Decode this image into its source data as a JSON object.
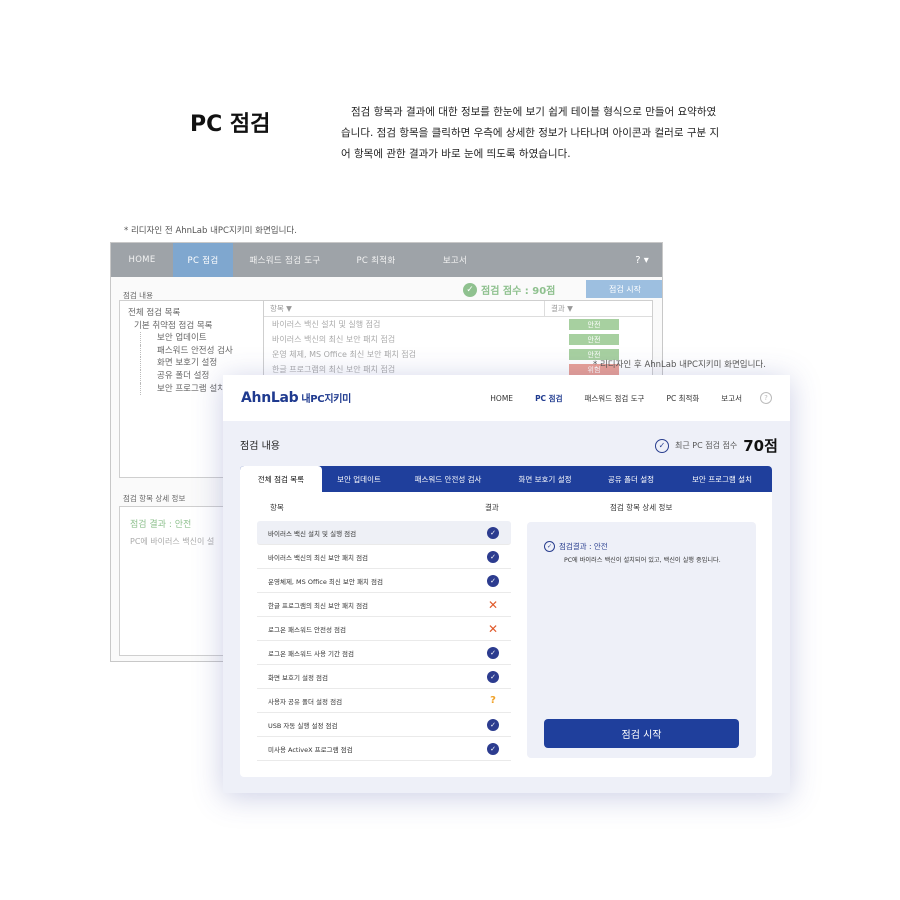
{
  "header": {
    "title": "PC 점검",
    "description": "점검 항목과 결과에 대한 정보를 한눈에 보기 쉽게 테이블 형식으로 만들어 요약하였습니다. 점검 항목을 클릭하면 우측에 상세한 정보가 나타나며 아이콘과 컬러로 구분 지어 항목에 관한 결과가 바로 눈에 띄도록 하였습니다."
  },
  "old": {
    "caption": "* 리디자인 전 AhnLab 내PC지키미 화면입니다.",
    "nav": [
      "HOME",
      "PC 점검",
      "패스워드 점검 도구",
      "PC 최적화",
      "보고서"
    ],
    "help": "? ▾",
    "section_title": "점검 내용",
    "score": "점검 점수 : 90점",
    "start_button": "점검 시작",
    "tree": {
      "root": "전체 점검 목록",
      "group": "기본 취약점 점검 목록",
      "children": [
        "보안 업데이트",
        "패스워드 안전성 검사",
        "화면 보호기 설정",
        "공유 폴더 설정",
        "보안 프로그램 설치"
      ]
    },
    "table": {
      "headers": [
        "항목 ▼",
        "결과 ▼"
      ],
      "rows": [
        {
          "item": "바이러스 백신 설치 및 실행 점검",
          "result": "안전",
          "color": "#a7d0a0"
        },
        {
          "item": "바이러스 백신의 최신 보안 패치 점검",
          "result": "안전",
          "color": "#a7d0a0"
        },
        {
          "item": "운영 체제, MS Office 최신 보안 패치 점검",
          "result": "안전",
          "color": "#a7d0a0"
        },
        {
          "item": "한글 프로그램의 최신 보안 패치 점검",
          "result": "위험",
          "color": "#e9a096"
        }
      ]
    },
    "detail_title": "점검 항목 상세 정보",
    "detail_result": "점검 결과 : 안전",
    "detail_desc": "PC에 바이러스 백신이 설"
  },
  "new": {
    "caption": "* 리디자인 후 AhnLab 내PC지키미 화면입니다.",
    "logo": "AhnLab",
    "logo_sub": "내PC지키미",
    "nav": [
      "HOME",
      "PC 점검",
      "패스워드 점검 도구",
      "PC 최적화",
      "보고서"
    ],
    "help": "?",
    "section_title": "점검 내용",
    "score_label": "최근 PC 점검 점수",
    "score_value": "70점",
    "tabs": [
      "전체 점검 목록",
      "보안 업데이트",
      "패스워드 안전성 검사",
      "화면 보호기 설정",
      "공유 폴더 설정",
      "보안 프로그램 설치"
    ],
    "col_item": "항목",
    "col_result": "결과",
    "col_detail": "점검 항목 상세 정보",
    "items": [
      {
        "label": "바이러스 백신 설치 및 실행 점검",
        "status": "ok"
      },
      {
        "label": "바이러스 백신의 최신 보안 패치 점검",
        "status": "ok"
      },
      {
        "label": "운영체제, MS Office 최신 보안 패치 점검",
        "status": "ok"
      },
      {
        "label": "한글 프로그램의 최신 보안 패치 점검",
        "status": "bad"
      },
      {
        "label": "로그온 패스워드 안전성 점검",
        "status": "bad"
      },
      {
        "label": "로그온 패스워드 사용 기간 점검",
        "status": "ok"
      },
      {
        "label": "화면 보호기 설정 점검",
        "status": "ok"
      },
      {
        "label": "사용자 공유 폴더 설정 점검",
        "status": "warn"
      },
      {
        "label": "USB 자동 실행 설정 점검",
        "status": "ok"
      },
      {
        "label": "미사용 ActiveX 프로그램 점검",
        "status": "ok"
      }
    ],
    "detail_result": "점검결과 : 안전",
    "detail_desc": "PC에 바이러스 백신이 설치되어 있고, 백신이 실행 중입니다.",
    "start_button": "점검 시작",
    "status_glyphs": {
      "ok": "✓",
      "bad": "✕",
      "warn": "?"
    }
  }
}
